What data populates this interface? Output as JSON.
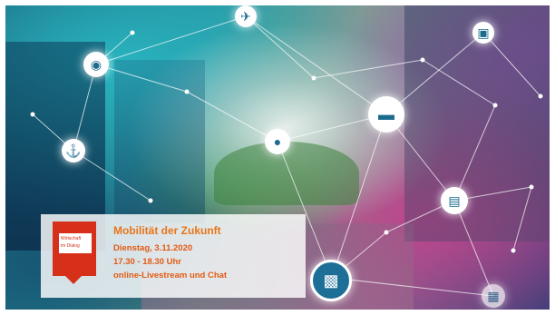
{
  "event": {
    "title": "Mobilität der Zukunft",
    "date": "Dienstag, 3.11.2020",
    "time": "17.30 - 18.30 Uhr",
    "format": "online-Livestream und Chat"
  },
  "logo": {
    "line1": "Wirtschaft",
    "line2": "im Dialog"
  },
  "colors": {
    "accent_orange": "#e8751a",
    "logo_red": "#d7301a",
    "node_blue": "#1d6f97"
  },
  "icons": [
    "airplane-icon",
    "car-icon",
    "ship-icon",
    "bus-icon",
    "motorbike-icon",
    "train-icon",
    "tram-icon"
  ]
}
